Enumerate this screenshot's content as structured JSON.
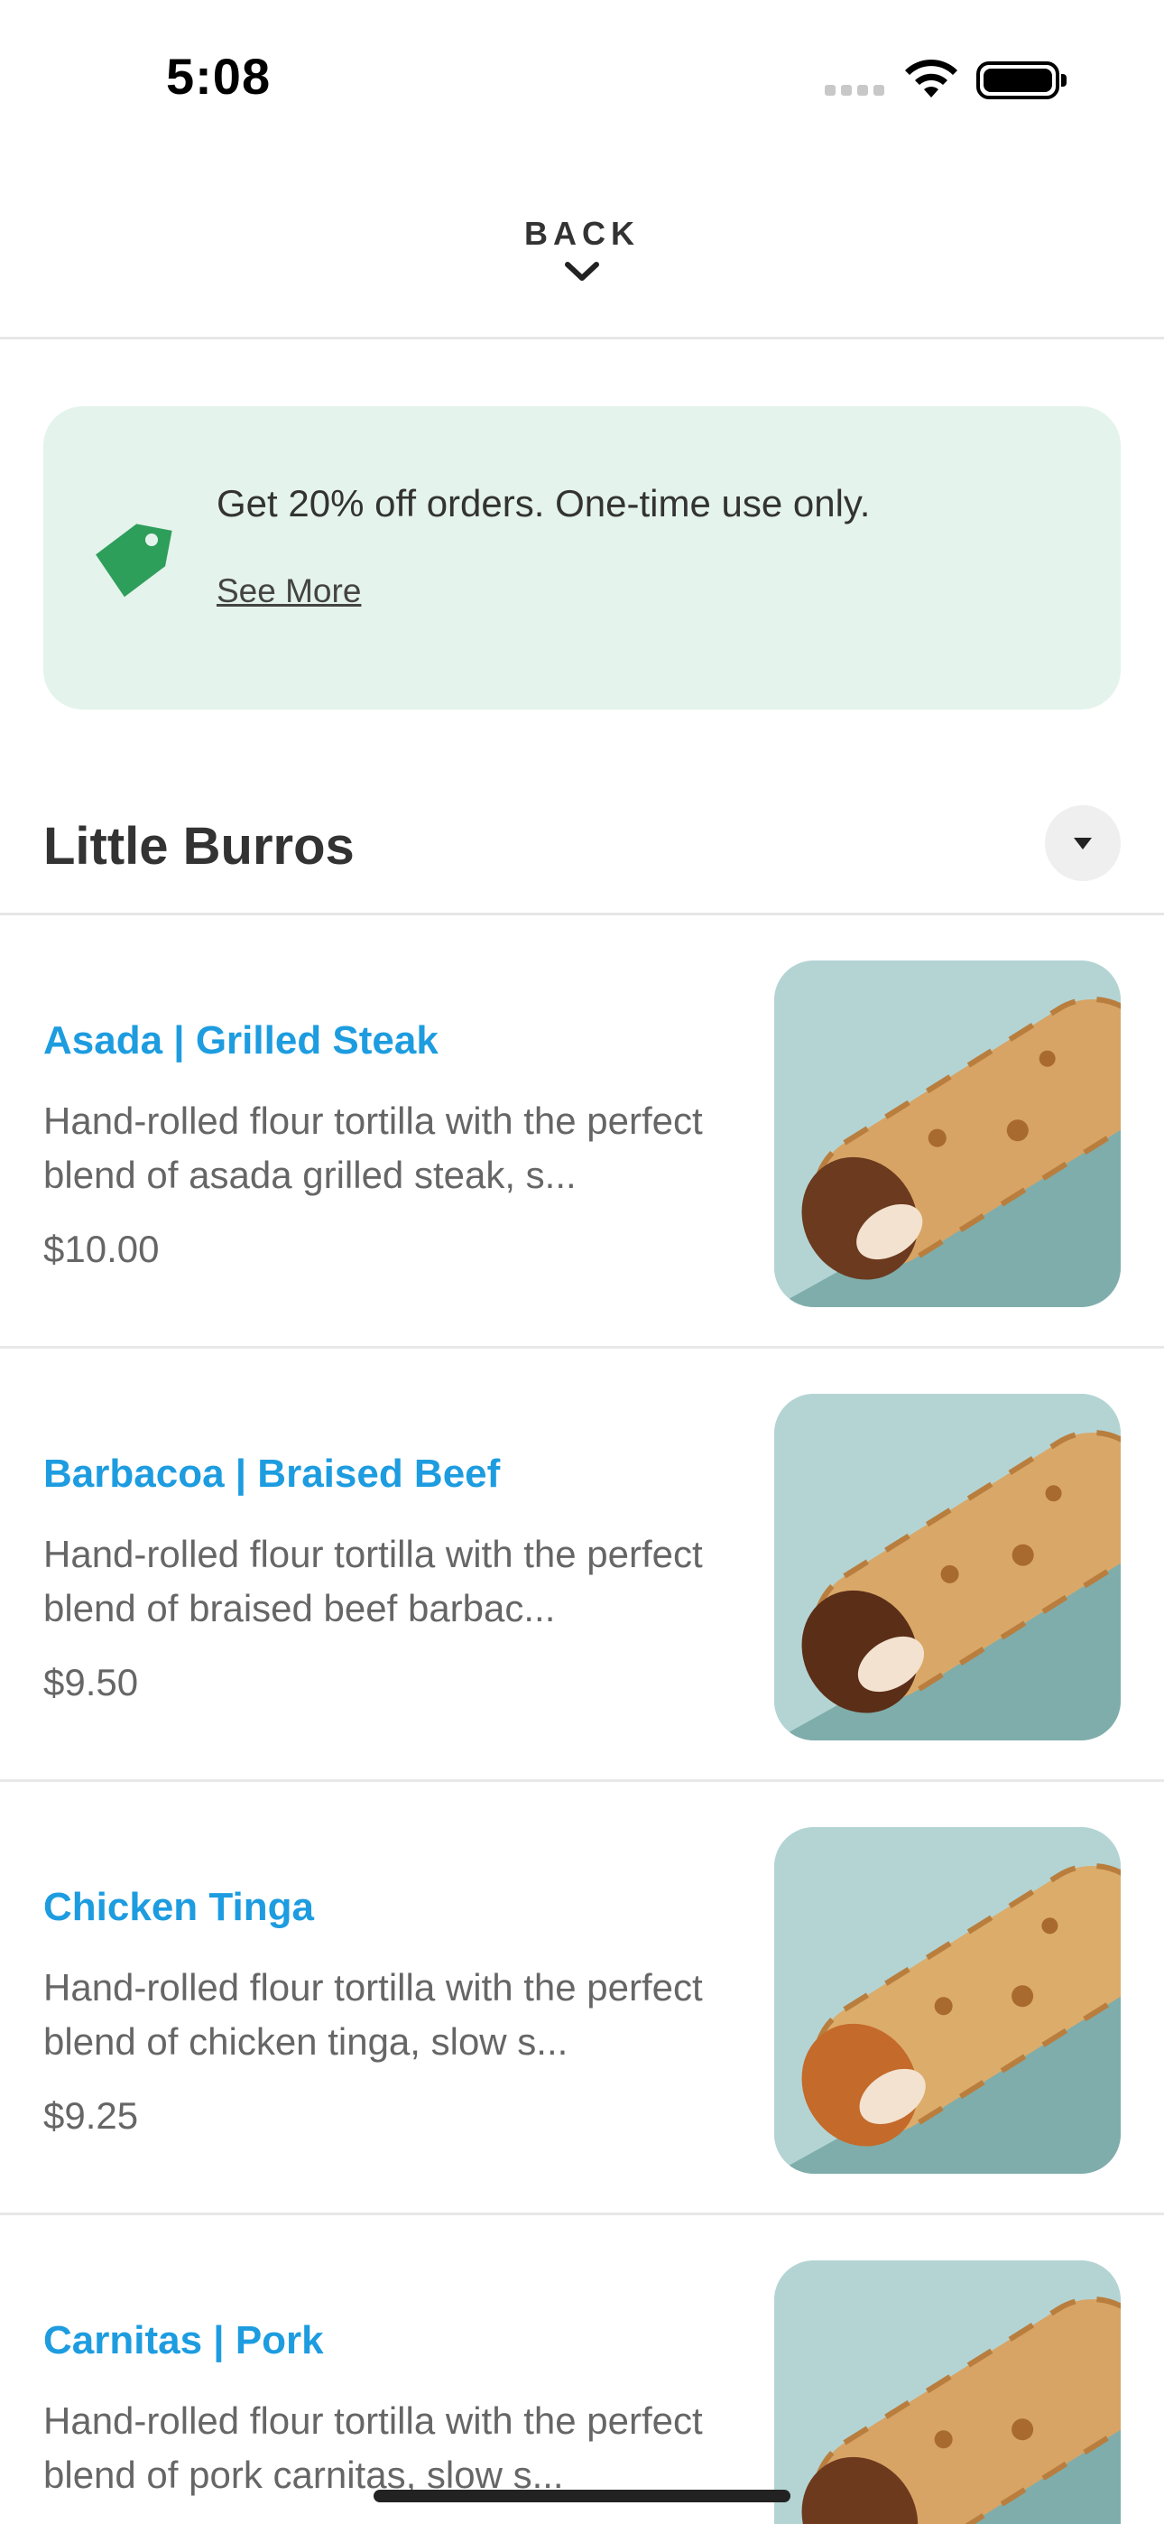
{
  "status_bar": {
    "time": "5:08"
  },
  "header": {
    "back_label": "BACK"
  },
  "promo": {
    "text": "Get 20% off orders. One-time use only.",
    "link": "See More",
    "icon": "tag-icon",
    "accent_color": "#2e9e5b"
  },
  "section": {
    "title": "Little Burros"
  },
  "items": [
    {
      "name": "Asada | Grilled Steak",
      "description": "Hand-rolled flour tortilla with the perfect blend of asada grilled steak, s...",
      "price": "$10.00"
    },
    {
      "name": "Barbacoa | Braised Beef",
      "description": "Hand-rolled flour tortilla with the perfect blend of braised beef barbac...",
      "price": "$9.50"
    },
    {
      "name": "Chicken Tinga",
      "description": "Hand-rolled flour tortilla with the perfect blend of chicken tinga, slow s...",
      "price": "$9.25"
    },
    {
      "name": "Carnitas | Pork",
      "description": "Hand-rolled flour tortilla with the perfect blend of pork carnitas, slow s...",
      "price": ""
    }
  ],
  "colors": {
    "item_name": "#1d9ce0",
    "promo_bg": "#e4f3eb",
    "image_bg_light": "#b4d4d4",
    "image_bg_dark": "#7fadab"
  }
}
